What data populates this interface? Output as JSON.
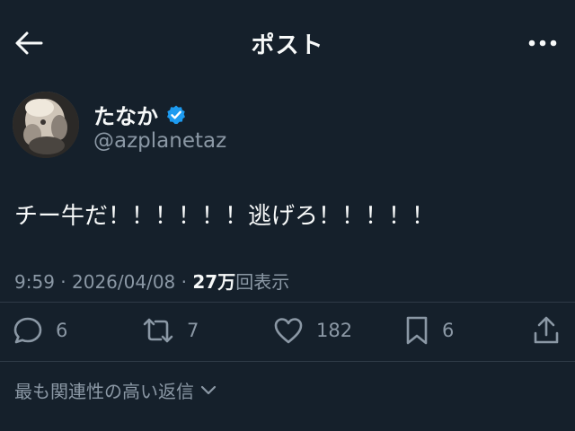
{
  "header": {
    "title": "ポスト",
    "back_icon": "back-arrow-icon",
    "more_icon": "more-horizontal-icon"
  },
  "author": {
    "display_name": "たなか",
    "handle": "@azplanetaz",
    "verified_color": "#1d9bf0"
  },
  "tweet": {
    "text": "チー牛だ！！！！！！逃げろ！！！！！",
    "time": "9:59",
    "separator1": " · ",
    "date": "2026/04/08",
    "separator2": " · ",
    "views_count": "27万",
    "views_label": "回表示"
  },
  "actions": {
    "replies": "6",
    "reposts": "7",
    "likes": "182",
    "bookmarks": "6"
  },
  "replies_sort": {
    "label": "最も関連性の高い返信"
  },
  "colors": {
    "background": "#15202b",
    "text": "#f7f9f9",
    "secondary": "#8b98a5",
    "accent": "#1d9bf0"
  }
}
